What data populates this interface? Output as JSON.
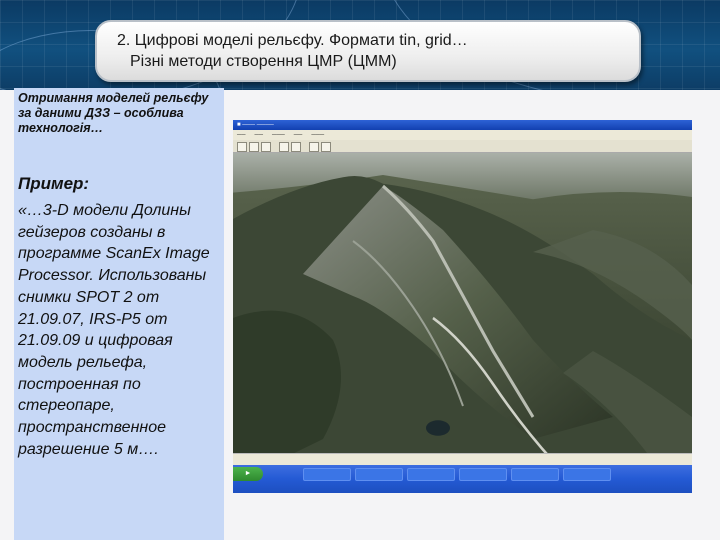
{
  "slide": {
    "title_line1": "2. Цифрові моделі рельєфу. Формати tin, grid…",
    "title_line2": "Різні методи створення ЦМР (ЦММ)",
    "intro_text": "Отримання моделей рельєфу за даними ДЗЗ – особлива технологія…",
    "example_heading": "Пример:",
    "example_text": "«…3-D модели Долины гейзеров созданы в программе ScanEx Image Processor. Использованы снимки SPOT 2 от 21.09.07, IRS-P5 от 21.09.09 и цифровая модель рельефа, построенная по стереопаре, пространственное разрешение 5 м…."
  },
  "colors": {
    "band": "#11507f",
    "panel": "#c7d8f6",
    "title_bg": "#eeeeee"
  },
  "icons": [
    "start-button-icon",
    "toolbar-button-icon"
  ]
}
